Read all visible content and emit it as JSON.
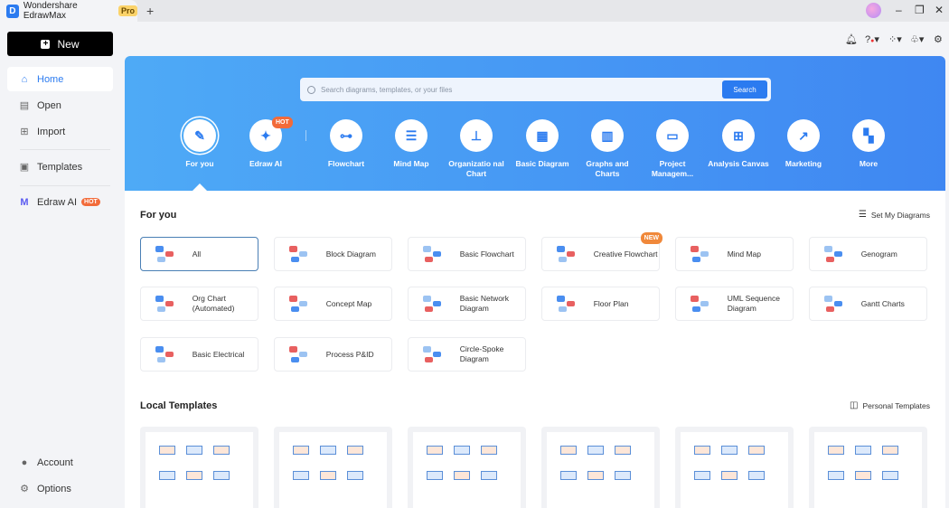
{
  "app": {
    "title": "Wondershare EdrawMax",
    "badge": "Pro"
  },
  "sidebar": {
    "new_label": "New",
    "items": [
      {
        "label": "Home"
      },
      {
        "label": "Open"
      },
      {
        "label": "Import"
      },
      {
        "label": "Templates"
      },
      {
        "label": "Edraw AI",
        "badge": "HOT"
      }
    ],
    "bottom": [
      {
        "label": "Account"
      },
      {
        "label": "Options"
      }
    ]
  },
  "search": {
    "placeholder": "Search diagrams, templates, or your files",
    "button": "Search"
  },
  "categories": [
    {
      "label": "For you"
    },
    {
      "label": "Edraw AI",
      "badge": "HOT"
    },
    {
      "label": "Flowchart"
    },
    {
      "label": "Mind Map"
    },
    {
      "label": "Organizatio nal Chart"
    },
    {
      "label": "Basic Diagram"
    },
    {
      "label": "Graphs and Charts"
    },
    {
      "label": "Project Managem..."
    },
    {
      "label": "Analysis Canvas"
    },
    {
      "label": "Marketing"
    },
    {
      "label": "More"
    }
  ],
  "for_you": {
    "title": "For you",
    "action": "Set My Diagrams",
    "cards": [
      {
        "label": "All"
      },
      {
        "label": "Block Diagram"
      },
      {
        "label": "Basic Flowchart"
      },
      {
        "label": "Creative Flowchart",
        "badge": "NEW"
      },
      {
        "label": "Mind Map"
      },
      {
        "label": "Genogram"
      },
      {
        "label": "Org Chart (Automated)"
      },
      {
        "label": "Concept Map"
      },
      {
        "label": "Basic Network Diagram"
      },
      {
        "label": "Floor Plan"
      },
      {
        "label": "UML Sequence Diagram"
      },
      {
        "label": "Gantt Charts"
      },
      {
        "label": "Basic Electrical"
      },
      {
        "label": "Process P&ID"
      },
      {
        "label": "Circle-Spoke Diagram"
      }
    ]
  },
  "local": {
    "title": "Local Templates",
    "action": "Personal Templates"
  },
  "colors": {
    "accent": "#2b7bf0",
    "hot": "#f26b3a",
    "hero_start": "#4eaaf6",
    "hero_end": "#3f87f2"
  }
}
